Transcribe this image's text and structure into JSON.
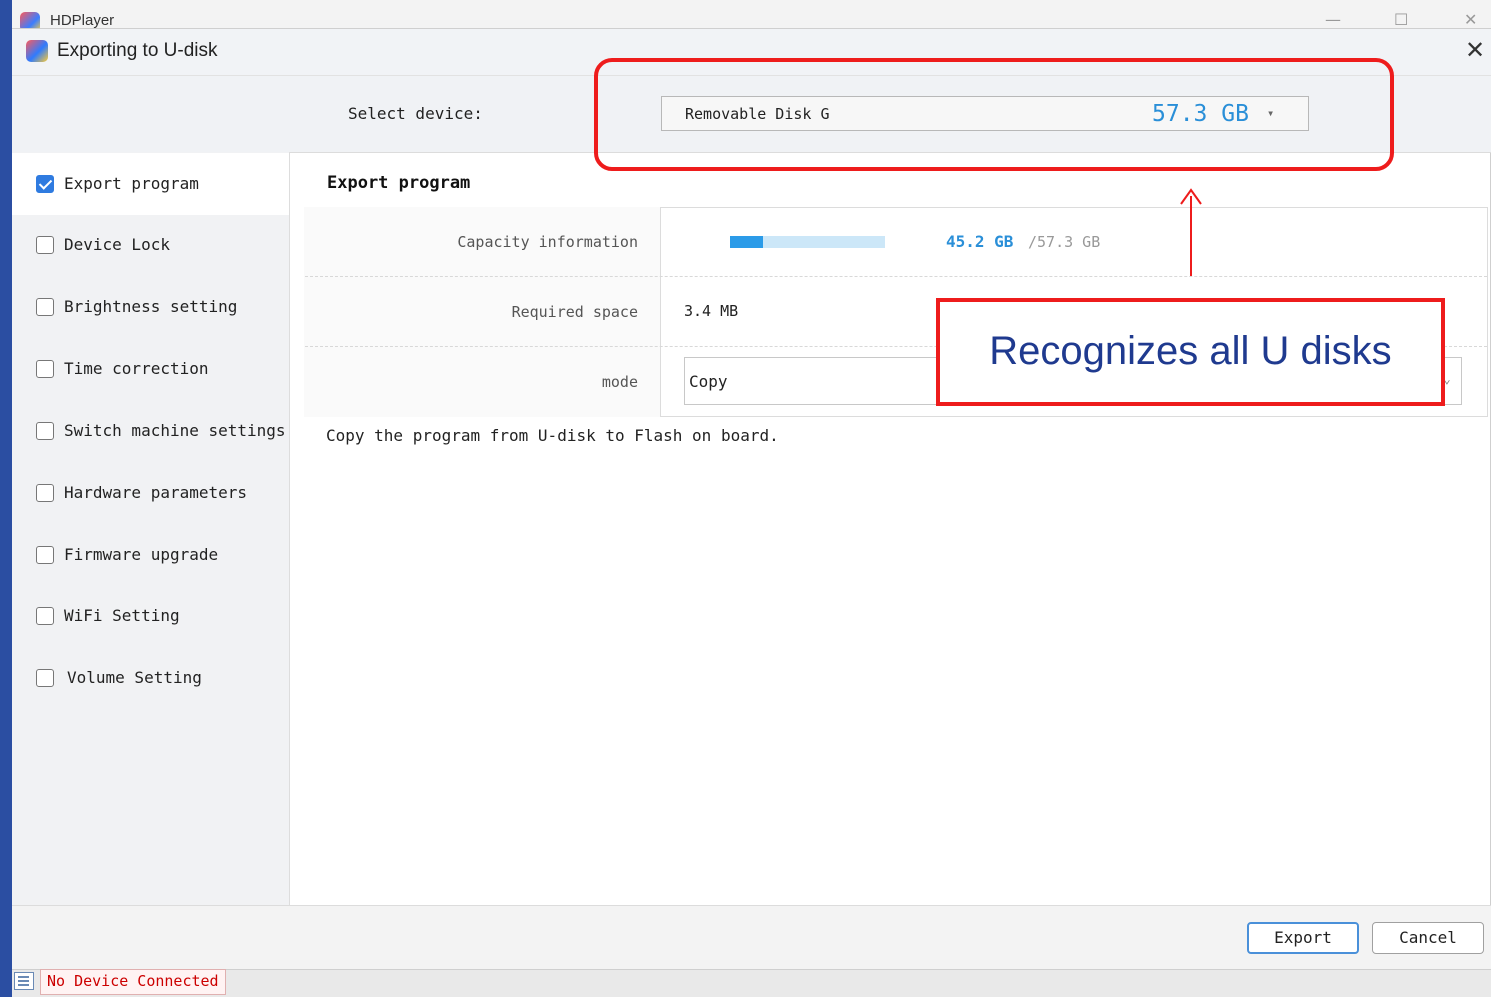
{
  "app": {
    "title": "HDPlayer",
    "minimize": "—",
    "maximize": "☐",
    "close": "✕"
  },
  "dialog": {
    "title": "Exporting to U-disk",
    "close": "✕",
    "select_device_label": "Select device:",
    "device": {
      "name": "Removable Disk G",
      "size": "57.3 GB",
      "caret": "▾"
    }
  },
  "sidebar": {
    "items": [
      {
        "label": "Export program",
        "checked": true
      },
      {
        "label": "Device Lock",
        "checked": false
      },
      {
        "label": "Brightness setting",
        "checked": false
      },
      {
        "label": "Time correction",
        "checked": false
      },
      {
        "label": "Switch machine settings",
        "checked": false
      },
      {
        "label": "Hardware parameters",
        "checked": false
      },
      {
        "label": "Firmware upgrade",
        "checked": false
      },
      {
        "label": "WiFi Setting",
        "checked": false
      },
      {
        "label": "Volume Setting",
        "checked": false
      }
    ]
  },
  "main": {
    "title": "Export program",
    "capacity": {
      "label": "Capacity information",
      "used": "45.2 GB",
      "total": "/57.3 GB",
      "used_fraction": 0.21
    },
    "required": {
      "label": "Required space",
      "value": "3.4 MB"
    },
    "mode": {
      "label": "mode",
      "value": "Copy",
      "caret": "⌄"
    },
    "description": "Copy the program from U-disk to Flash on board."
  },
  "annotation": {
    "text": "Recognizes all U disks",
    "arrow": "↑",
    "color": "#ee1c1c"
  },
  "footer": {
    "export_label": "Export",
    "cancel_label": "Cancel"
  },
  "status": {
    "text": "No Device Connected"
  }
}
